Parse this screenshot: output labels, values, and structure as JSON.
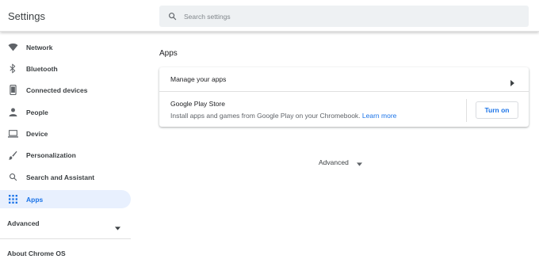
{
  "app": {
    "title": "Settings"
  },
  "search": {
    "placeholder": "Search settings",
    "value": ""
  },
  "sidebar": {
    "items": [
      {
        "label": "Network",
        "icon": "wifi-icon"
      },
      {
        "label": "Bluetooth",
        "icon": "bluetooth-icon"
      },
      {
        "label": "Connected devices",
        "icon": "phone-icon"
      },
      {
        "label": "People",
        "icon": "person-icon"
      },
      {
        "label": "Device",
        "icon": "laptop-icon"
      },
      {
        "label": "Personalization",
        "icon": "brush-icon"
      },
      {
        "label": "Search and Assistant",
        "icon": "search-icon"
      },
      {
        "label": "Apps",
        "icon": "apps-grid-icon",
        "active": true
      }
    ],
    "advanced_label": "Advanced",
    "about_label": "About Chrome OS"
  },
  "main": {
    "section_title": "Apps",
    "manage_apps_label": "Manage your apps",
    "play_store": {
      "title": "Google Play Store",
      "description": "Install apps and games from Google Play on your Chromebook.",
      "link_label": "Learn more",
      "button_label": "Turn on"
    },
    "advanced_label": "Advanced"
  },
  "colors": {
    "accent": "#1a73e8",
    "active_bg": "#e8f0fe",
    "search_bg": "#eef1f3",
    "text_primary": "#202124",
    "text_secondary": "#5f6368"
  }
}
